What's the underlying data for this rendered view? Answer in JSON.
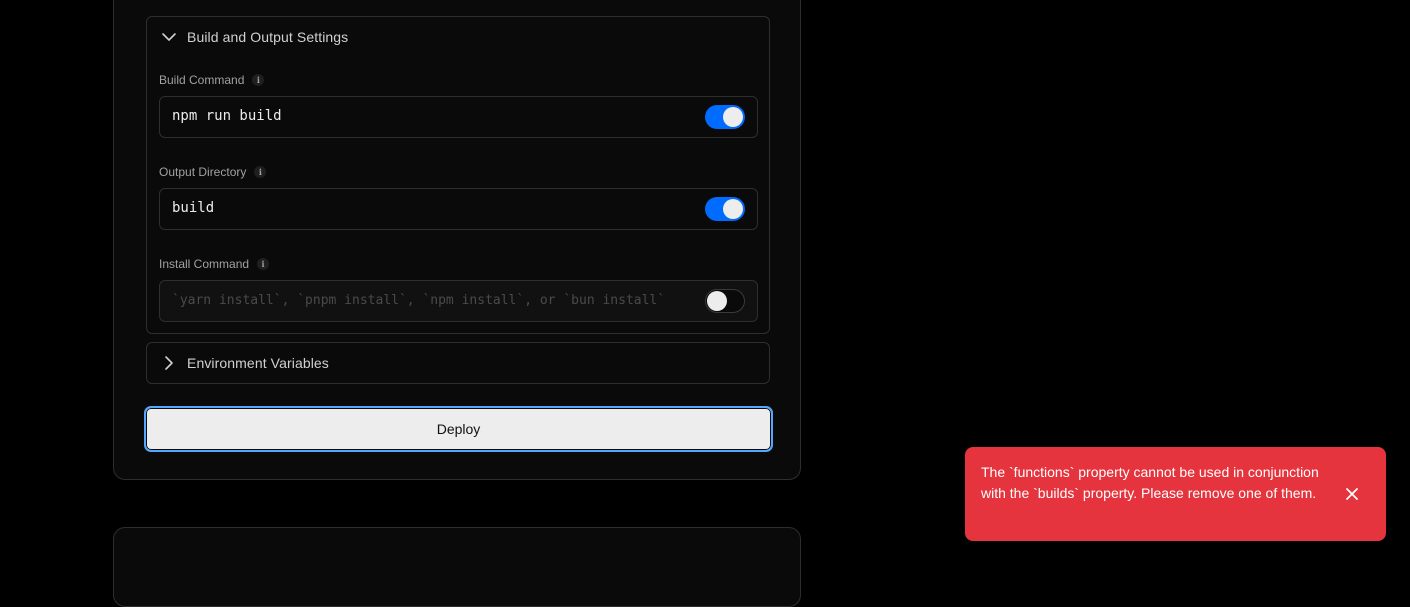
{
  "build_settings": {
    "title": "Build and Output Settings",
    "expanded": true,
    "fields": [
      {
        "label": "Build Command",
        "value": "npm run build",
        "placeholder": "",
        "override_enabled": true
      },
      {
        "label": "Output Directory",
        "value": "build",
        "placeholder": "",
        "override_enabled": true
      },
      {
        "label": "Install Command",
        "value": "",
        "placeholder": "`yarn install`, `pnpm install`, `npm install`, or `bun install`",
        "override_enabled": false
      }
    ]
  },
  "environment_variables": {
    "title": "Environment Variables",
    "expanded": false
  },
  "deploy": {
    "label": "Deploy"
  },
  "toast": {
    "message": "The `functions` property cannot be used in conjunction with the `builds` property. Please remove one of them.",
    "type": "error",
    "color": "#e5343d"
  },
  "colors": {
    "accent": "#006bff",
    "focus_ring": "#52a8ff"
  }
}
